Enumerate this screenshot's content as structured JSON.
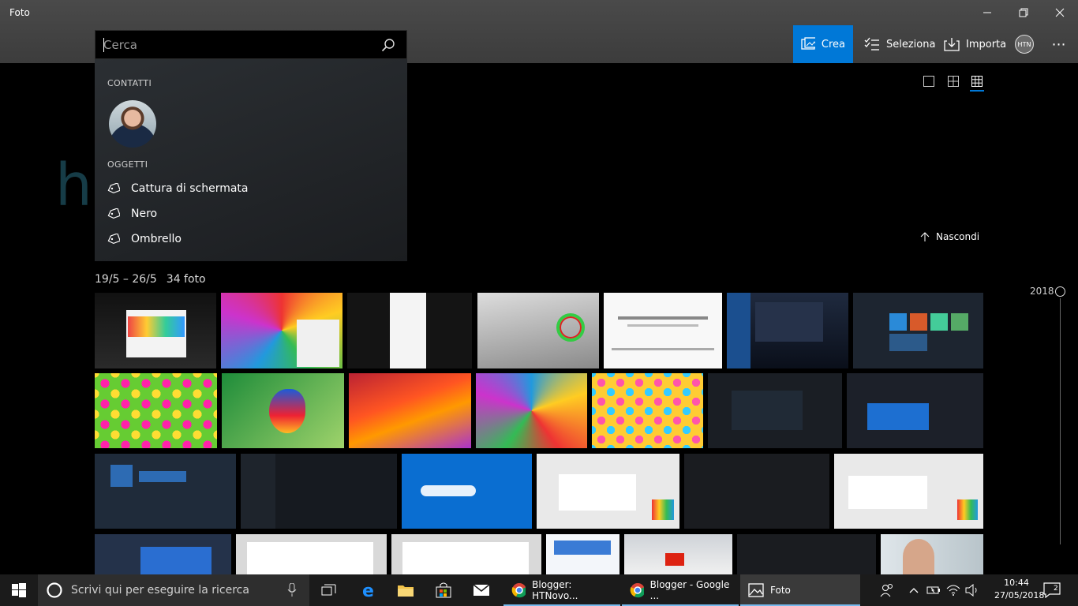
{
  "app": {
    "title": "Foto"
  },
  "commands": {
    "create": "Crea",
    "select": "Seleziona",
    "import": "Importa",
    "account": "HTN",
    "more": "⋯"
  },
  "search": {
    "placeholder": "Cerca",
    "contacts_header": "CONTATTI",
    "objects_header": "OGGETTI",
    "tags": [
      "Cattura di schermata",
      "Nero",
      "Ombrello"
    ]
  },
  "watermark": "htnovo.net",
  "gallery": {
    "hide_label": "Nascondi",
    "date_range": "19/5 – 26/5",
    "count": "34 foto",
    "year": "2018"
  },
  "taskbar": {
    "search_placeholder": "Scrivi qui per eseguire la ricerca",
    "apps": [
      "Blogger: HTNovo...",
      "Blogger - Google ...",
      "Foto"
    ],
    "time": "10:44",
    "date": "27/05/2018",
    "notifications": "2"
  },
  "colors": {
    "accent": "#0078d7",
    "titlebar": "#444444",
    "taskbar": "#1b1b1b"
  }
}
